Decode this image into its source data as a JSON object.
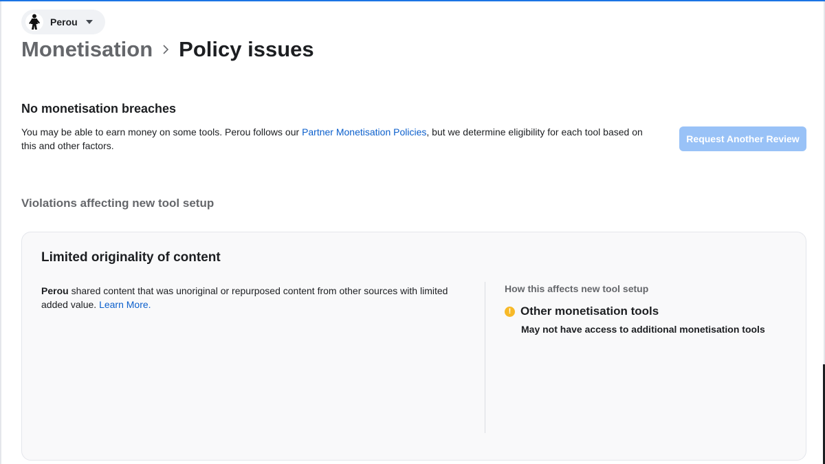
{
  "page_switcher": {
    "name": "Perou"
  },
  "breadcrumb": {
    "parent": "Monetisation",
    "current": "Policy issues"
  },
  "status": {
    "title": "No monetisation breaches",
    "desc_before": "You may be able to earn money on some tools. Perou follows our ",
    "link": "Partner Monetisation Policies",
    "desc_after": ", but we determine eligibility for each tool based on this and other factors.",
    "review_button": "Request Another Review"
  },
  "violations": {
    "heading": "Violations affecting new tool setup",
    "card": {
      "title": "Limited originality of content",
      "desc_bold": "Perou",
      "desc_text": " shared content that was unoriginal or repurposed content from other sources with limited added value. ",
      "learn_more": "Learn More.",
      "effects_label": "How this affects new tool setup",
      "effect_icon": "warning-icon",
      "effect_title": "Other monetisation tools",
      "effect_desc": "May not have access to additional monetisation tools"
    }
  },
  "colors": {
    "accent": "#1b74e4",
    "link": "#0b5fcc",
    "button_disabled": "#99c2f7",
    "warning": "#f7b928"
  }
}
